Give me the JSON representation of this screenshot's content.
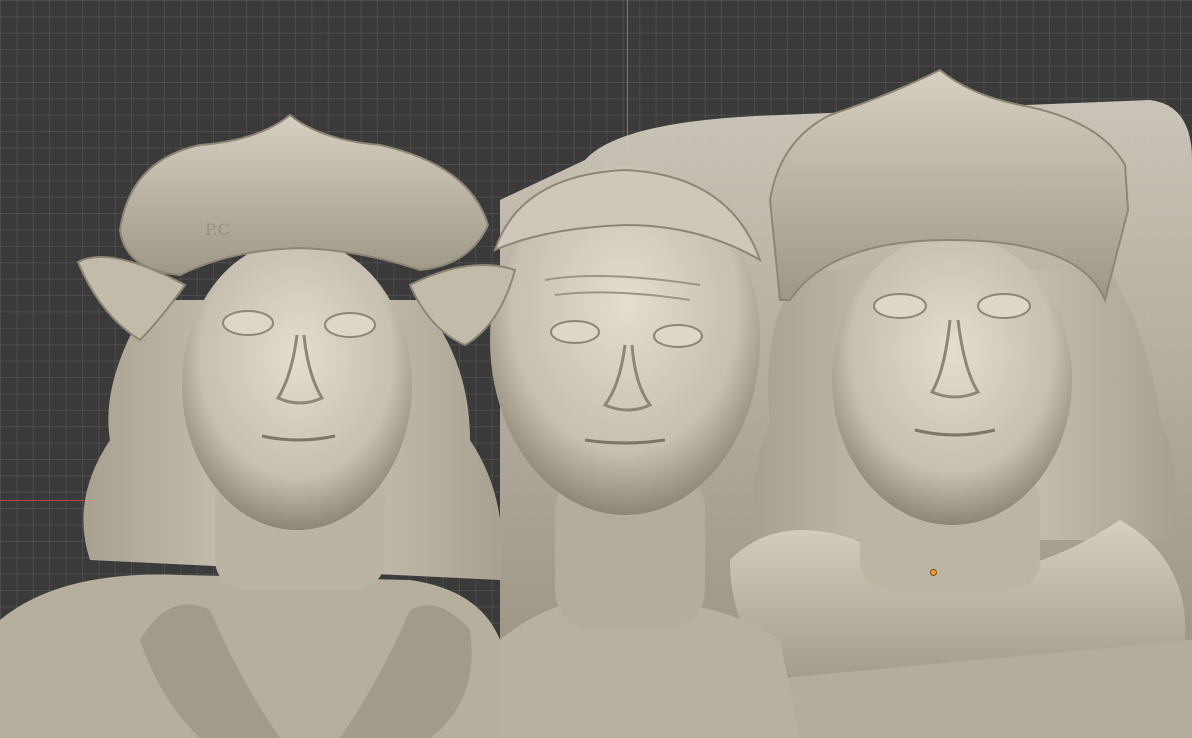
{
  "viewport": {
    "grid_color": "#5a5a5a",
    "background_color": "#3a3a3a",
    "axis_y_color": "#4f7ec9",
    "axis_x_color": "#b34444",
    "pivot_color": "#f0a030"
  },
  "model": {
    "material_color": "#c7bfb0",
    "shadow_color": "#8e8675",
    "highlight_color": "#e4ddd0",
    "cap_inscription": "P.C",
    "figures": [
      {
        "name": "left-figure",
        "headwear": "cap-with-ear-flaps"
      },
      {
        "name": "center-figure",
        "headwear": "skullcap"
      },
      {
        "name": "right-figure",
        "headwear": "tall-cap"
      }
    ]
  }
}
